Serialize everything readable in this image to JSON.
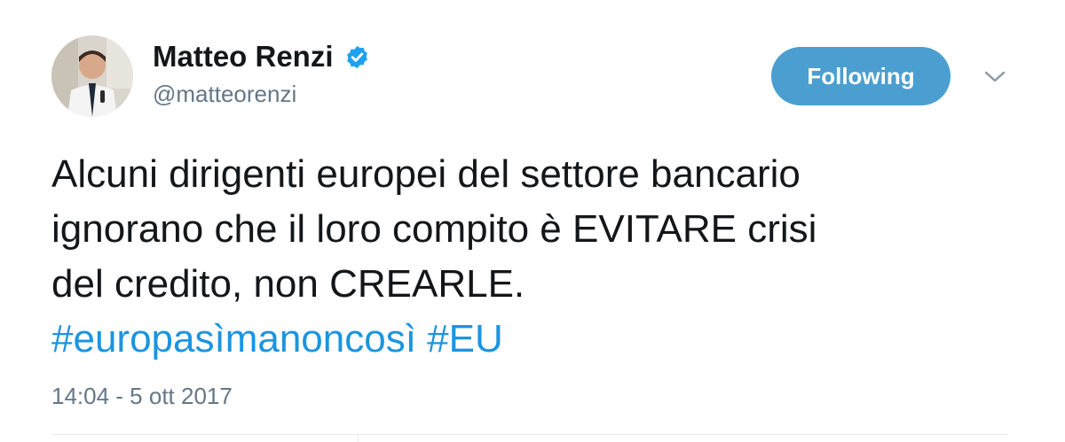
{
  "author": {
    "name": "Matteo Renzi",
    "handle": "@matteorenzi",
    "verified": true
  },
  "actions": {
    "follow_label": "Following",
    "more_icon": "chevron-down-icon"
  },
  "tweet": {
    "text_lines": [
      "Alcuni dirigenti europei del settore bancario",
      "ignorano che il loro compito è EVITARE crisi",
      "del credito, non CREARLE."
    ],
    "hashtags": [
      "#europasìmanoncosì",
      "#EU"
    ],
    "timestamp": "14:04 - 5 ott 2017"
  },
  "colors": {
    "follow_button": "#4a9fd0",
    "hashtag": "#1b95e0",
    "verified_badge": "#1da1f2",
    "muted_text": "#657786"
  }
}
